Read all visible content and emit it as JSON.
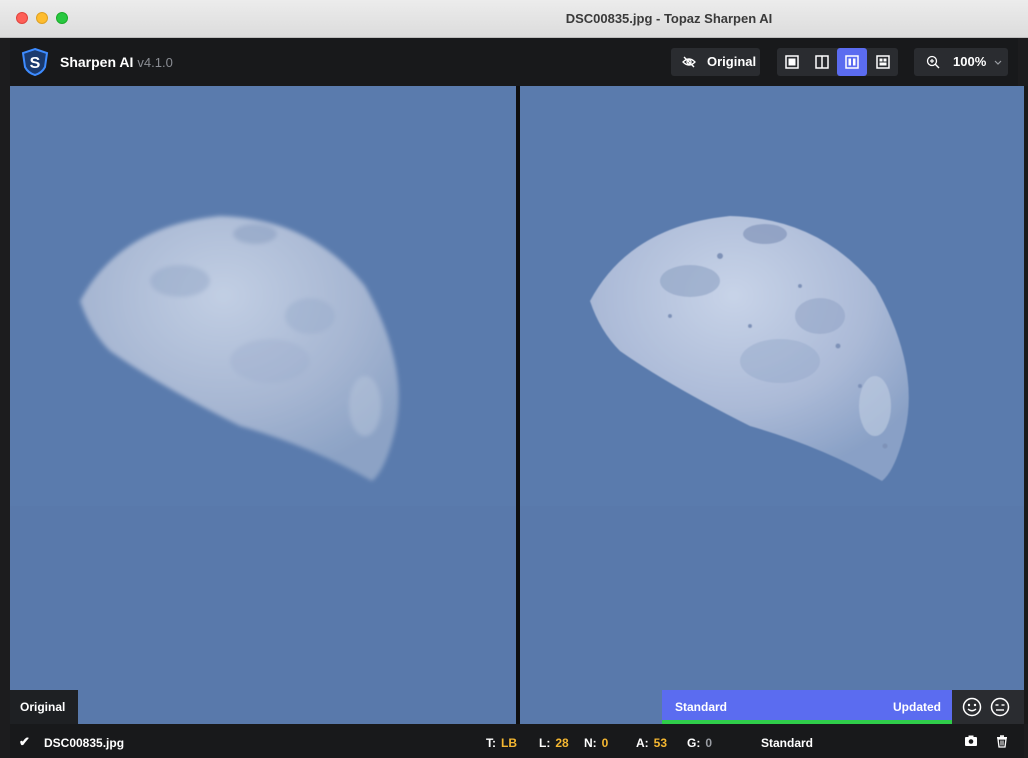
{
  "window": {
    "title": "DSC00835.jpg - Topaz Sharpen AI"
  },
  "header": {
    "app_name": "Sharpen AI",
    "version": "v4.1.0",
    "original_toggle_label": "Original",
    "view_modes": [
      "single-view",
      "split-view",
      "side-by-side-view",
      "comparison-view"
    ],
    "active_view": "side-by-side-view",
    "zoom": "100%"
  },
  "panes": {
    "left_label": "Original",
    "model_name": "Standard",
    "model_status": "Updated",
    "progress": 1.0
  },
  "statusbar": {
    "filename": "DSC00835.jpg",
    "params": [
      {
        "key": "T:",
        "value": "LB",
        "dim": false
      },
      {
        "key": "L:",
        "value": "28",
        "dim": false
      },
      {
        "key": "N:",
        "value": "0",
        "dim": false
      },
      {
        "key": "A:",
        "value": "53",
        "dim": false
      },
      {
        "key": "G:",
        "value": "0",
        "dim": true
      }
    ],
    "model": "Standard"
  },
  "colors": {
    "accent": "#5b6cf0",
    "progress": "#2fcc4a",
    "param_value": "#f5b731",
    "sky": "#5a7bad"
  }
}
